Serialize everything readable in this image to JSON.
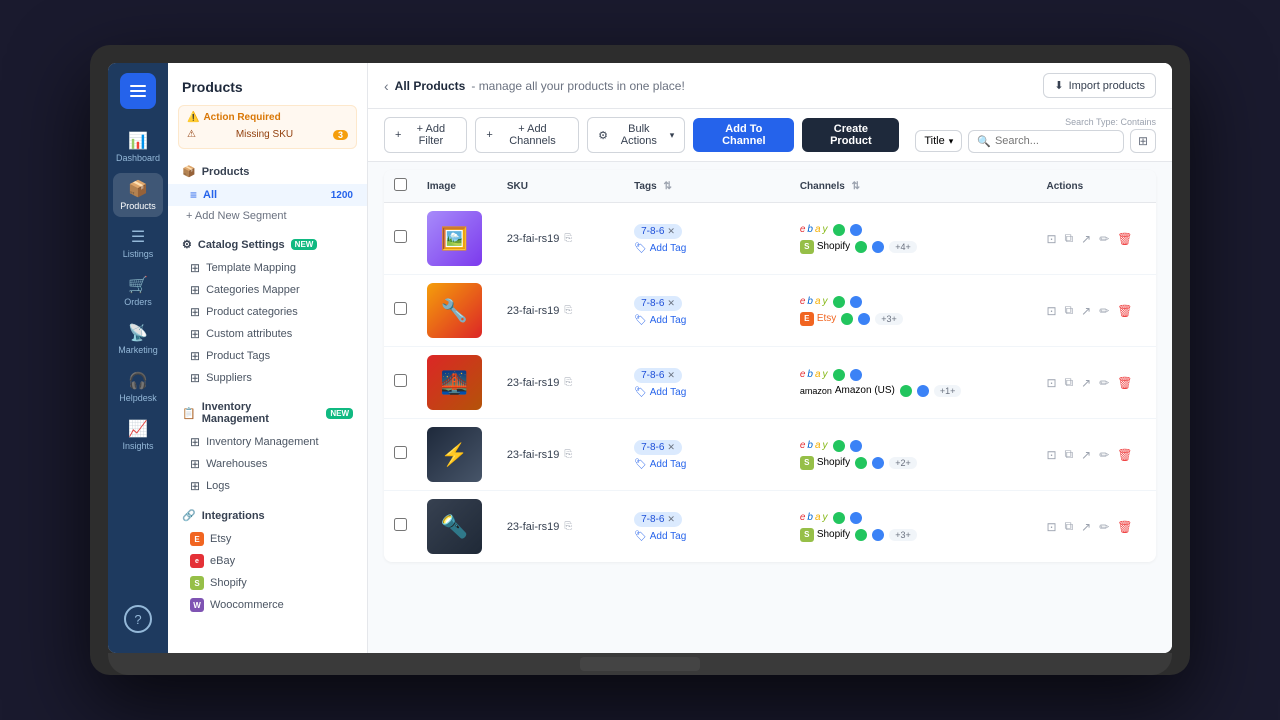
{
  "app": {
    "title": "Products"
  },
  "header": {
    "back_label": "‹",
    "breadcrumb_current": "All Products",
    "breadcrumb_sub": "- manage all your products in one place!",
    "import_label": "Import products"
  },
  "toolbar": {
    "add_filter_label": "+ Add Filter",
    "add_channels_label": "+ Add Channels",
    "bulk_actions_label": "Bulk Actions",
    "add_to_channel_label": "Add To Channel",
    "create_product_label": "Create Product",
    "search_type_label": "Search Type: Contains",
    "search_placeholder": "Search...",
    "title_select": "Title",
    "grid_icon": "⊞"
  },
  "alert": {
    "title": "Action Required",
    "items": [
      {
        "label": "Missing SKU",
        "count": "3"
      }
    ]
  },
  "sidebar": {
    "title": "Products",
    "segments": {
      "all_label": "All",
      "all_count": "1200"
    },
    "add_segment_label": "+ Add New Segment",
    "catalog_settings": {
      "label": "Catalog Settings",
      "badge": "NEW",
      "items": [
        {
          "icon": "⊞",
          "label": "Template Mapping"
        },
        {
          "icon": "⊞",
          "label": "Categories Mapper"
        },
        {
          "icon": "⊞",
          "label": "Product categories"
        },
        {
          "icon": "⊞",
          "label": "Custom attributes"
        },
        {
          "icon": "⊞",
          "label": "Product Tags"
        },
        {
          "icon": "⊞",
          "label": "Suppliers"
        }
      ]
    },
    "inventory": {
      "label": "Inventory Management",
      "badge": "NEW",
      "items": [
        {
          "icon": "⊞",
          "label": "Inventory Management"
        },
        {
          "icon": "⊞",
          "label": "Warehouses"
        },
        {
          "icon": "⊞",
          "label": "Logs"
        }
      ]
    },
    "integrations": {
      "label": "Integrations",
      "items": [
        {
          "label": "Etsy",
          "type": "etsy"
        },
        {
          "label": "eBay",
          "type": "ebay"
        },
        {
          "label": "Shopify",
          "type": "shopify"
        },
        {
          "label": "Woocommerce",
          "type": "woo"
        }
      ]
    }
  },
  "nav": {
    "items": [
      {
        "label": "Dashboard",
        "icon": "📊"
      },
      {
        "label": "Products",
        "icon": "📦",
        "active": true
      },
      {
        "label": "Listings",
        "icon": "☰"
      },
      {
        "label": "Orders",
        "icon": "🛒"
      },
      {
        "label": "Marketing",
        "icon": "📡"
      },
      {
        "label": "Helpdesk",
        "icon": "🎧"
      },
      {
        "label": "Insights",
        "icon": "📈"
      }
    ],
    "help_label": "?"
  },
  "table": {
    "columns": [
      "",
      "Image",
      "SKU",
      "Tags",
      "Channels",
      "Actions"
    ],
    "rows": [
      {
        "sku": "23-fai-rs19",
        "tag": "7-8-6",
        "channels": [
          {
            "name": "eBay",
            "type": "ebay",
            "dots": [
              "green",
              "blue"
            ]
          },
          {
            "name": "Shopify",
            "type": "shopify",
            "dots": [
              "green",
              "blue"
            ],
            "more": "+4+"
          }
        ],
        "img_class": "img-1"
      },
      {
        "sku": "23-fai-rs19",
        "tag": "7-8-6",
        "channels": [
          {
            "name": "eBay",
            "type": "ebay",
            "dots": [
              "green",
              "blue"
            ]
          },
          {
            "name": "Etsy",
            "type": "etsy",
            "dots": [
              "green",
              "blue"
            ],
            "more": "+3+"
          }
        ],
        "img_class": "img-2"
      },
      {
        "sku": "23-fai-rs19",
        "tag": "7-8-6",
        "channels": [
          {
            "name": "eBay",
            "type": "ebay",
            "dots": [
              "green",
              "blue"
            ]
          },
          {
            "name": "Amazon (US)",
            "type": "amazon",
            "dots": [
              "green",
              "blue"
            ],
            "more": "+1+"
          }
        ],
        "img_class": "img-3"
      },
      {
        "sku": "23-fai-rs19",
        "tag": "7-8-6",
        "channels": [
          {
            "name": "eBay",
            "type": "ebay",
            "dots": [
              "green",
              "blue"
            ]
          },
          {
            "name": "Shopify",
            "type": "shopify",
            "dots": [
              "green",
              "blue"
            ],
            "more": "+2+"
          }
        ],
        "img_class": "img-4"
      },
      {
        "sku": "23-fai-rs19",
        "tag": "7-8-6",
        "channels": [
          {
            "name": "eBay",
            "type": "ebay",
            "dots": [
              "green",
              "blue"
            ]
          },
          {
            "name": "Shopify",
            "type": "shopify",
            "dots": [
              "green",
              "blue"
            ],
            "more": "+3+"
          }
        ],
        "img_class": "img-5"
      }
    ]
  }
}
